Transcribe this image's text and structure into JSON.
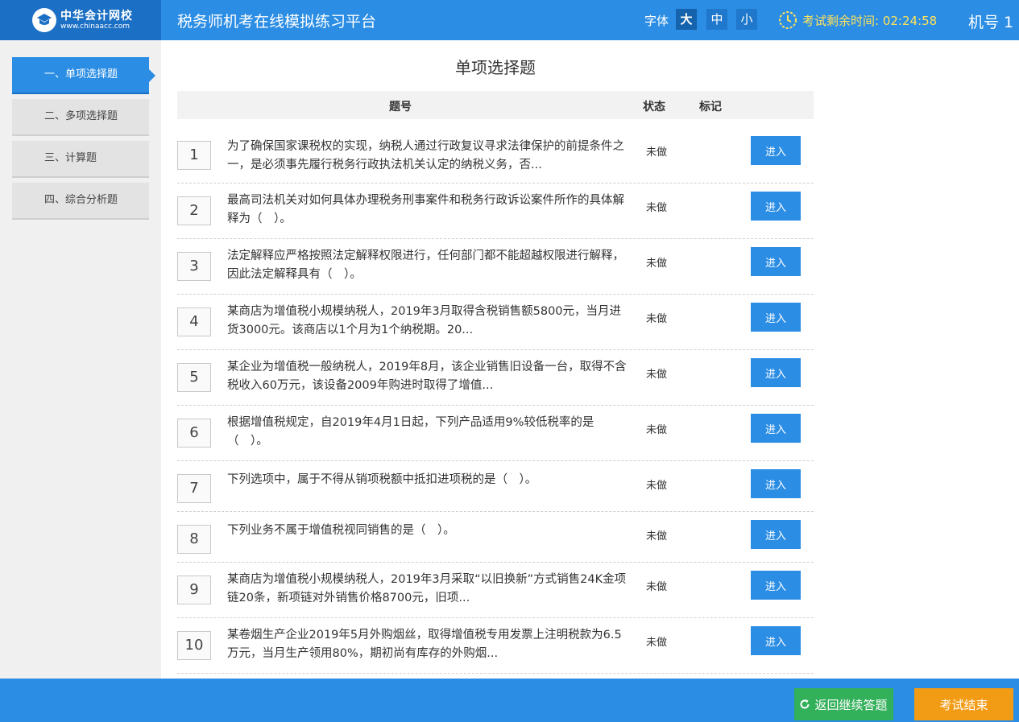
{
  "header": {
    "logo_name": "中华会计网校",
    "logo_url": "www.chinaacc.com",
    "title": "税务师机考在线模拟练习平台",
    "font_label": "字体",
    "font_sizes": [
      "大",
      "中",
      "小"
    ],
    "font_selected": "大",
    "timer_label": "考试剩余时间:",
    "timer_value": "02:24:58",
    "machine_label": "机号 1"
  },
  "sidebar": {
    "items": [
      {
        "label": "一、单项选择题",
        "active": true
      },
      {
        "label": "二、多项选择题",
        "active": false
      },
      {
        "label": "三、计算题",
        "active": false
      },
      {
        "label": "四、综合分析题",
        "active": false
      }
    ]
  },
  "main": {
    "section_title": "单项选择题",
    "columns": {
      "number": "题号",
      "status": "状态",
      "mark": "标记"
    },
    "enter_label": "进入",
    "questions": [
      {
        "num": "1",
        "text": "为了确保国家课税权的实现，纳税人通过行政复议寻求法律保护的前提条件之一，是必须事先履行税务行政执法机关认定的纳税义务，否...",
        "status": "未做"
      },
      {
        "num": "2",
        "text": "最高司法机关对如何具体办理税务刑事案件和税务行政诉讼案件所作的具体解释为（　）。",
        "status": "未做"
      },
      {
        "num": "3",
        "text": "法定解释应严格按照法定解释权限进行，任何部门都不能超越权限进行解释，因此法定解释具有（　）。",
        "status": "未做"
      },
      {
        "num": "4",
        "text": "某商店为增值税小规模纳税人，2019年3月取得含税销售额5800元，当月进货3000元。该商店以1个月为1个纳税期。20...",
        "status": "未做"
      },
      {
        "num": "5",
        "text": "某企业为增值税一般纳税人，2019年8月，该企业销售旧设备一台，取得不含税收入60万元，该设备2009年购进时取得了增值...",
        "status": "未做"
      },
      {
        "num": "6",
        "text": "根据增值税规定，自2019年4月1日起，下列产品适用9%较低税率的是（　）。",
        "status": "未做"
      },
      {
        "num": "7",
        "text": "下列选项中，属于不得从销项税额中抵扣进项税的是（　）。",
        "status": "未做"
      },
      {
        "num": "8",
        "text": "下列业务不属于增值税视同销售的是（　）。",
        "status": "未做"
      },
      {
        "num": "9",
        "text": "某商店为增值税小规模纳税人，2019年3月采取“以旧换新”方式销售24K金项链20条，新项链对外销售价格8700元，旧项...",
        "status": "未做"
      },
      {
        "num": "10",
        "text": "某卷烟生产企业2019年5月外购烟丝，取得增值税专用发票上注明税款为6.5万元，当月生产领用80%，期初尚有库存的外购烟...",
        "status": "未做"
      }
    ]
  },
  "footer": {
    "return_label": "返回继续答题",
    "end_label": "考试结束"
  },
  "colors": {
    "primary": "#2b8de4",
    "header_logo_bg": "#1b6fc4",
    "timer": "#ffe35a",
    "return_button": "#33b05a",
    "end_button": "#f29b15"
  },
  "icons": [
    "logo-icon",
    "clock-icon",
    "refresh-icon"
  ]
}
